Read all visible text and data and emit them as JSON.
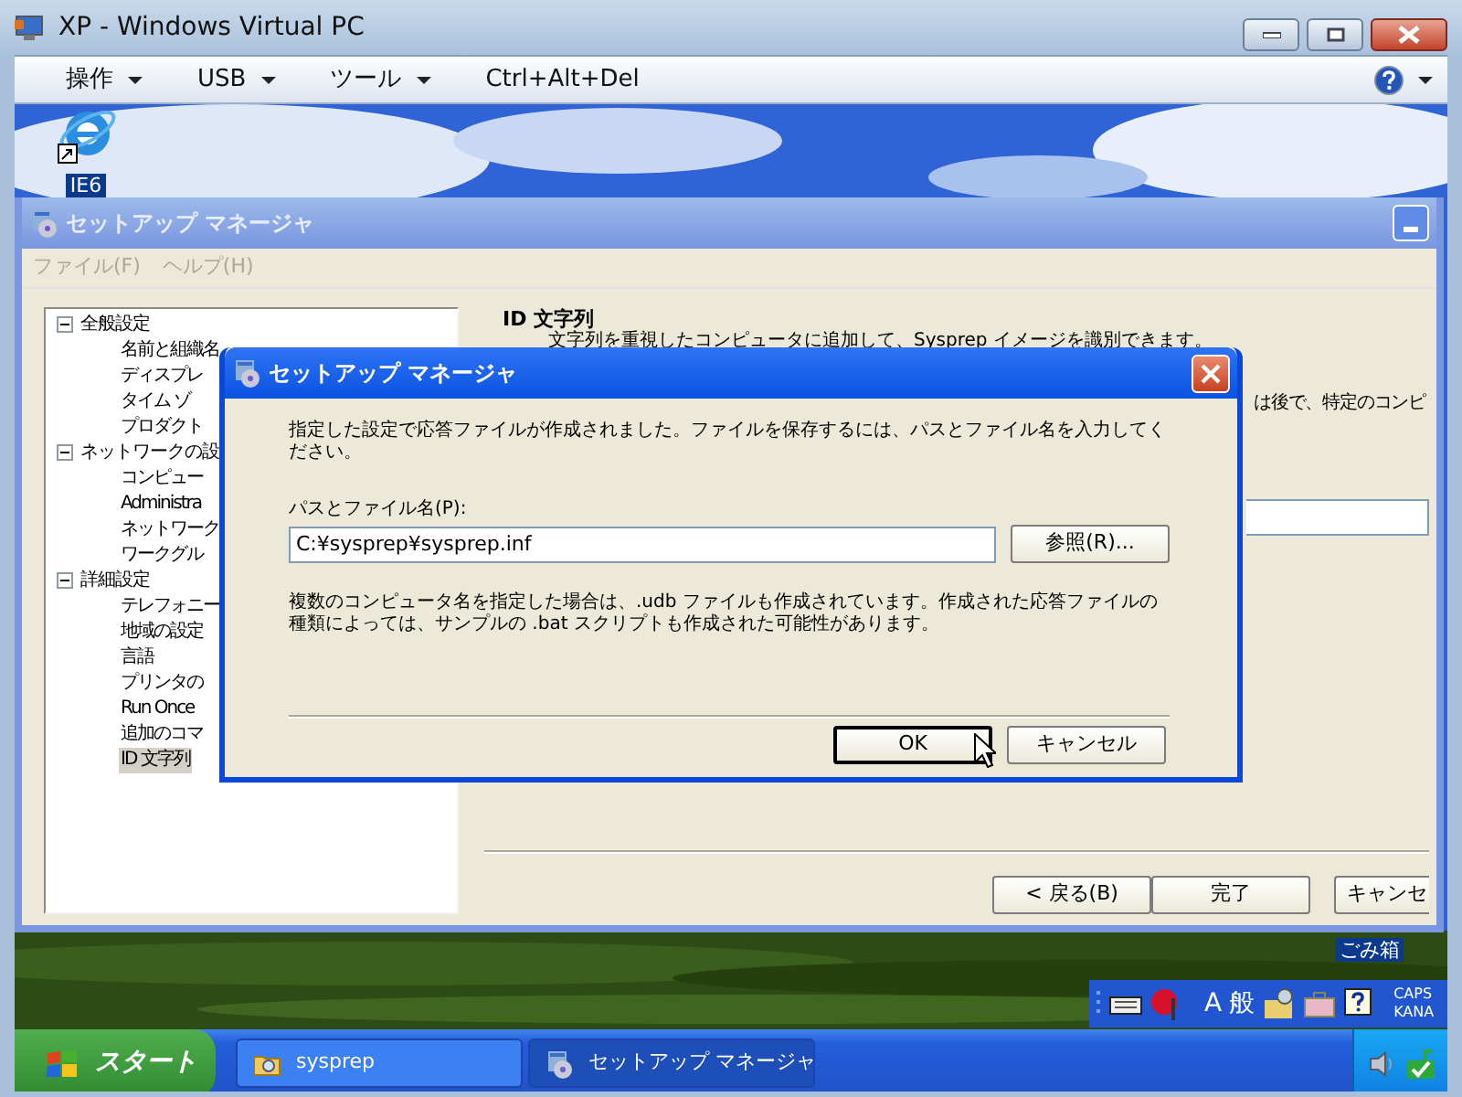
{
  "window": {
    "title": "XP - Windows Virtual PC"
  },
  "menu": [
    {
      "label": "操作",
      "kind": "dropdown"
    },
    {
      "label": "USB",
      "kind": "dropdown"
    },
    {
      "label": "ツール",
      "kind": "dropdown"
    },
    {
      "label": "Ctrl+Alt+Del",
      "kind": "command"
    }
  ],
  "desktop": {
    "icons": [
      {
        "label": "IE6",
        "kind": "browser"
      },
      {
        "label": "ごみ箱",
        "kind": "bin"
      }
    ]
  },
  "setup_manager": {
    "title": "セットアップ マネージャ",
    "menu": [
      {
        "label": "ファイル(F)",
        "disabled": true
      },
      {
        "label": "ヘルプ(H)",
        "disabled": true
      }
    ],
    "tree": [
      {
        "label": "全般設定",
        "expanded": true,
        "children": [
          {
            "label": "名前と組織名",
            "selected": false
          },
          {
            "label": "ディスプレ",
            "selected": false
          },
          {
            "label": "タイム ゾ",
            "selected": false
          },
          {
            "label": "プロダクト",
            "selected": false
          }
        ]
      },
      {
        "label": "ネットワークの設",
        "expanded": true,
        "children": [
          {
            "label": "コンピュー",
            "selected": false
          },
          {
            "label": "Administra",
            "selected": false
          },
          {
            "label": "ネットワーク",
            "selected": false
          },
          {
            "label": "ワークグル",
            "selected": false
          }
        ]
      },
      {
        "label": "詳細設定",
        "expanded": true,
        "children": [
          {
            "label": "テレフォニー",
            "selected": false
          },
          {
            "label": "地域の設定",
            "selected": false
          },
          {
            "label": "言語",
            "selected": false
          },
          {
            "label": "プリンタの",
            "selected": false
          },
          {
            "label": "Run Once",
            "selected": false
          },
          {
            "label": "追加のコマ",
            "selected": false
          },
          {
            "label": "ID 文字列",
            "selected": true
          }
        ]
      }
    ],
    "page": {
      "heading": "ID 文字列",
      "description": "文字列を重視したコンピュータに追加して、Sysprep イメージを識別できます。",
      "note": "は後で、特定のコンピ",
      "buttons": [
        "< 戻る(B)",
        "完了",
        "キャンセ"
      ]
    }
  },
  "dialog": {
    "title": "セットアップ マネージャ",
    "message": "指定した設定で応答ファイルが作成されました。ファイルを保存するには、パスとファイル名を入力してください。",
    "path_label": "パスとファイル名(P):",
    "path_value": "C:¥sysprep¥sysprep.inf",
    "browse_button": "参照(R)...",
    "note": "複数のコンピュータ名を指定した場合は、.udb ファイルも作成されています。作成された応答ファイルの種類によっては、サンプルの .bat スクリプトも作成された可能性があります。",
    "buttons": [
      {
        "label": "OK",
        "focused": true
      },
      {
        "label": "キャンセル",
        "focused": false
      }
    ]
  },
  "language_bar": {
    "mode": "A",
    "input": "般",
    "caps": "CAPS",
    "kana": "KANA"
  },
  "taskbar": {
    "start": "スタート",
    "tasks": [
      {
        "label": "sysprep",
        "kind": "folder",
        "selected": false
      },
      {
        "label": "セットアップ マネージャ",
        "kind": "setup",
        "selected": true
      }
    ]
  }
}
